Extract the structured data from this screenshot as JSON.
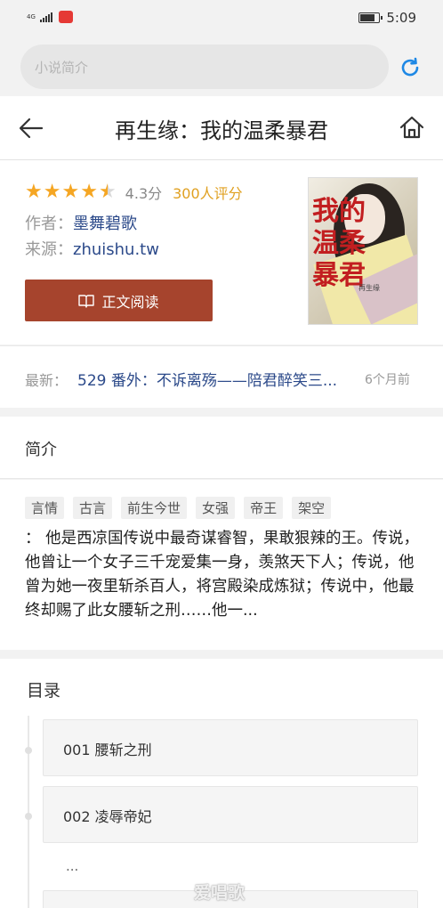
{
  "status_bar": {
    "network": "4G",
    "carrier_tag": "4G",
    "time": "5:09",
    "app_icon": "news-app-icon",
    "battery_level": 0.8
  },
  "search": {
    "placeholder": "小说简介",
    "refresh_icon": "refresh-icon"
  },
  "header": {
    "title": "再生缘：我的温柔暴君",
    "back_icon": "back-arrow-icon",
    "home_icon": "home-icon"
  },
  "book": {
    "rating_stars": 4.3,
    "max_stars": 5,
    "score": "4.3分",
    "rating_count": "300人评分",
    "author_label": "作者：",
    "author": "墨舞碧歌",
    "source_label": "来源：",
    "source": "zhuishu.tw",
    "read_button": "正文阅读",
    "cover_title": "我的温柔暴君",
    "cover_author": "再生缘"
  },
  "latest": {
    "label": "最新：",
    "chapter": "529 番外：不诉离殇——陪君醉笑三...",
    "time": "6个月前"
  },
  "intro": {
    "title": "简介",
    "tags": [
      "言情",
      "古言",
      "前生今世",
      "女强",
      "帝王",
      "架空"
    ],
    "text": "：  他是西凉国传说中最奇谋睿智，果敢狠辣的王。传说，他曾让一个女子三千宠爱集一身，羡煞天下人；传说，他曾为她一夜里斩杀百人，将宫殿染成炼狱；传说中，他最终却赐了此女腰斩之刑……他一..."
  },
  "toc": {
    "title": "目录",
    "items": [
      "001 腰斩之刑",
      "002 凌辱帝妃"
    ],
    "more": "..."
  },
  "watermark": "爱唱歌"
}
